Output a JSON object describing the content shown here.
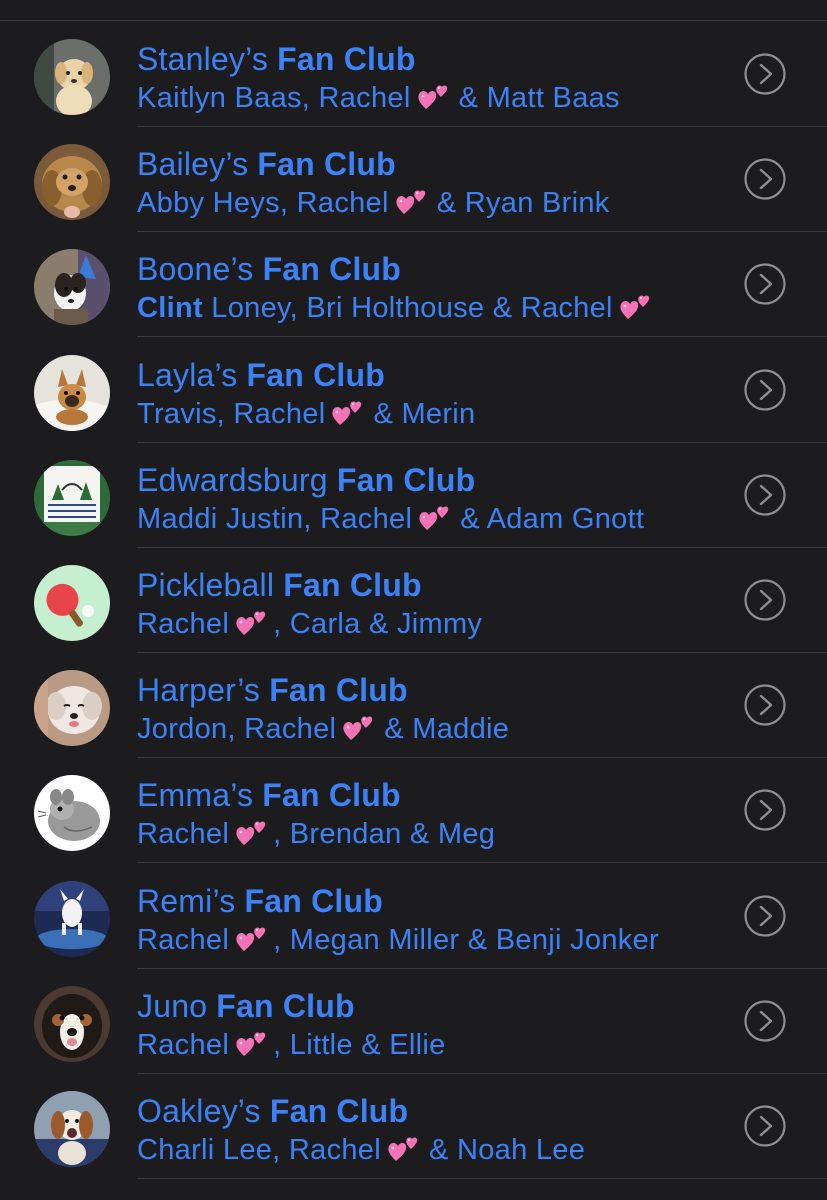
{
  "clubs": [
    {
      "name": "Stanley’s",
      "suffix": "Fan Club",
      "avatar": "golden-puppy-photo",
      "members": [
        {
          "t": "Kaitlyn Baas, Rachel"
        },
        {
          "heart": true
        },
        {
          "t": "& Matt Baas"
        }
      ]
    },
    {
      "name": "Bailey’s",
      "suffix": "Fan Club",
      "avatar": "golden-dog-photo",
      "members": [
        {
          "t": "Abby Heys, Rachel"
        },
        {
          "heart": true
        },
        {
          "t": "& Ryan Brink"
        }
      ]
    },
    {
      "name": "Boone’s",
      "suffix": "Fan Club",
      "avatar": "party-dog-photo",
      "members": [
        {
          "t": "Clint",
          "bold": true
        },
        {
          "t": " Loney, Bri Holthouse & Rachel"
        },
        {
          "heart": true
        }
      ]
    },
    {
      "name": "Layla’s",
      "suffix": "Fan Club",
      "avatar": "small-dog-bed-photo",
      "members": [
        {
          "t": "Travis, Rachel"
        },
        {
          "heart": true
        },
        {
          "t": "& Merin"
        }
      ]
    },
    {
      "name": "Edwardsburg",
      "suffix": "Fan Club",
      "avatar": "conservation-club-sign-photo",
      "members": [
        {
          "t": "Maddi Justin, Rachel"
        },
        {
          "heart": true
        },
        {
          "t": "& Adam Gnott"
        }
      ]
    },
    {
      "name": "Pickleball",
      "suffix": "Fan Club",
      "avatar": "ping-pong-emoji",
      "members": [
        {
          "t": "Rachel"
        },
        {
          "heart": true,
          "tight": true
        },
        {
          "t": ", Carla & Jimmy"
        }
      ]
    },
    {
      "name": "Harper’s",
      "suffix": "Fan Club",
      "avatar": "white-dog-photo",
      "members": [
        {
          "t": "Jordon, Rachel"
        },
        {
          "heart": true
        },
        {
          "t": "& Maddie"
        }
      ]
    },
    {
      "name": "Emma’s",
      "suffix": "Fan Club",
      "avatar": "chinchilla-drawing",
      "members": [
        {
          "t": "Rachel"
        },
        {
          "heart": true,
          "tight": true
        },
        {
          "t": ", Brendan & Meg"
        }
      ]
    },
    {
      "name": "Remi’s",
      "suffix": "Fan Club",
      "avatar": "dog-trampoline-photo",
      "members": [
        {
          "t": "Rachel"
        },
        {
          "heart": true,
          "tight": true
        },
        {
          "t": ", Megan Miller & Benji Jonker"
        }
      ]
    },
    {
      "name": "Juno",
      "suffix": "Fan Club",
      "avatar": "bernese-dog-photo",
      "members": [
        {
          "t": "Rachel"
        },
        {
          "heart": true,
          "tight": true
        },
        {
          "t": ", Little & Ellie"
        }
      ]
    },
    {
      "name": "Oakley’s",
      "suffix": "Fan Club",
      "avatar": "beagle-photo",
      "members": [
        {
          "t": "Charli Lee, Rachel"
        },
        {
          "heart": true
        },
        {
          "t": "& Noah Lee"
        }
      ]
    }
  ],
  "colors": {
    "accent": "#3b82f6",
    "background": "#1c1c1e",
    "separator": "#3a3a3c",
    "chevron": "#8e8e93",
    "heart": "#f472b6"
  }
}
